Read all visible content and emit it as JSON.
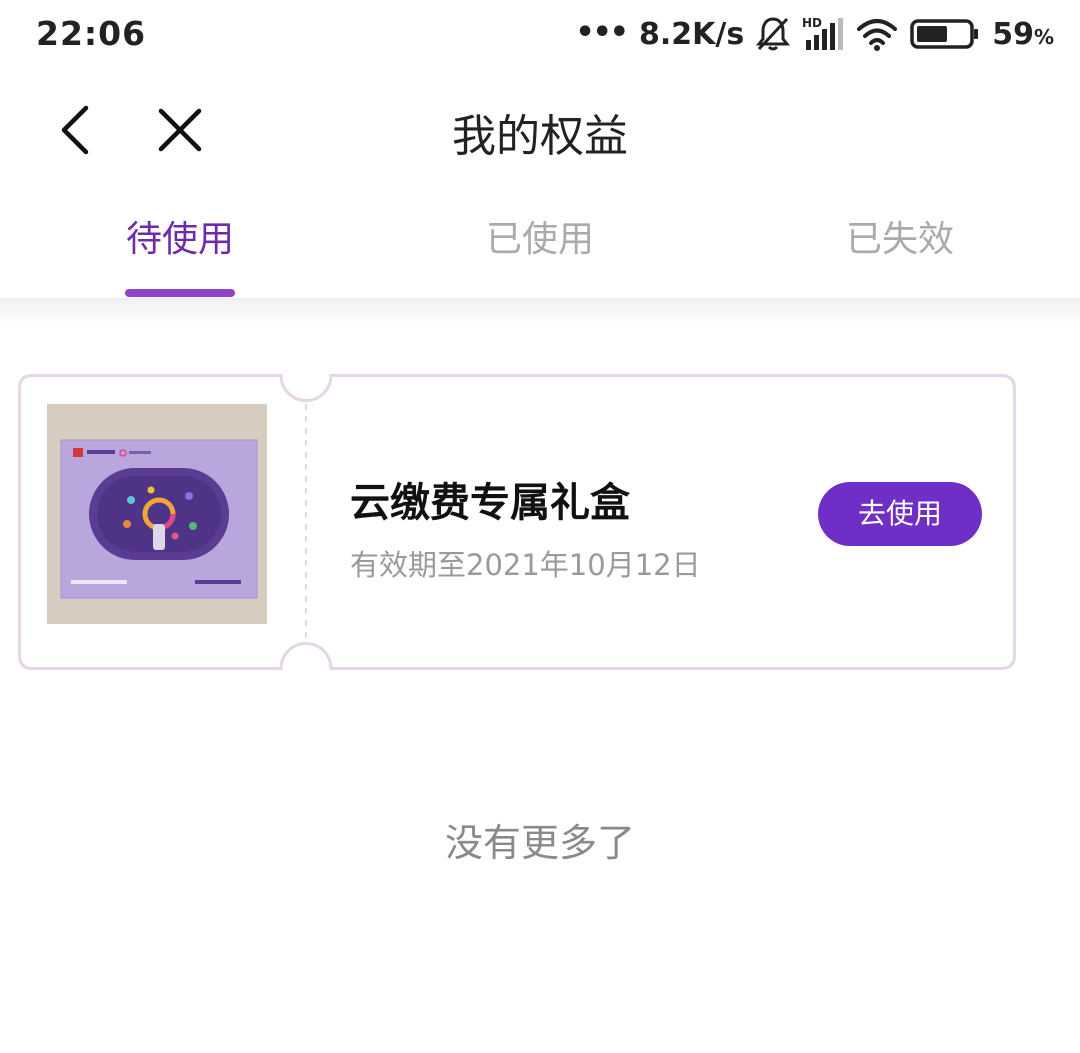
{
  "status_bar": {
    "time": "22:06",
    "dots": "•••",
    "net_speed": "8.2K/s",
    "network_badge": "HD",
    "battery_value": "59",
    "battery_unit": "%",
    "battery_level": 0.59,
    "icons": [
      "bell-muted-icon",
      "signal-icon",
      "wifi-icon",
      "battery-icon"
    ]
  },
  "nav": {
    "title": "我的权益",
    "icons": [
      "back-arrow-icon",
      "close-icon"
    ]
  },
  "tabs": [
    {
      "label": "待使用",
      "active": true
    },
    {
      "label": "已使用",
      "active": false
    },
    {
      "label": "已失效",
      "active": false
    }
  ],
  "coupon": {
    "name": "云缴费专属礼盒",
    "expiry": "有效期至2021年10月12日",
    "button_label": "去使用"
  },
  "footer": {
    "no_more": "没有更多了"
  },
  "colors": {
    "accent": "#6f2aa8",
    "indicator": "#8e44c9",
    "button": "#6f2fc6",
    "card_border": "#e4d6e6"
  }
}
